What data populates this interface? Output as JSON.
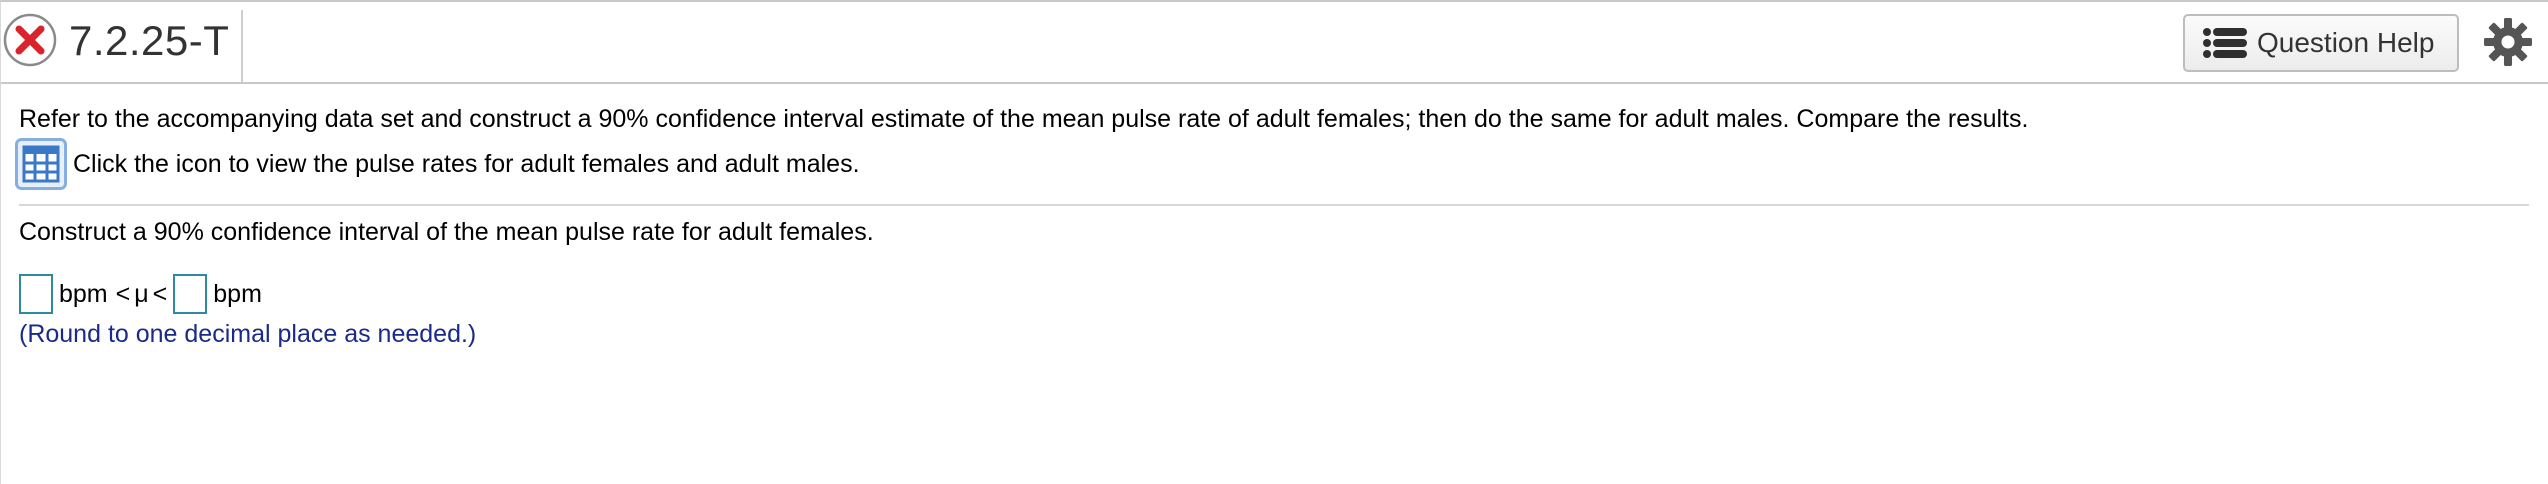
{
  "header": {
    "question_id": "7.2.25-T",
    "help_label": "Question Help"
  },
  "question": {
    "intro": "Refer to the accompanying data set and construct a 90% confidence interval estimate of the mean pulse rate of adult females; then do the same for adult males. Compare the results.",
    "table_link_text": "Click the icon to view the pulse rates for adult females and adult males.",
    "part_prompt": "Construct a 90% confidence interval of the mean pulse rate for adult females.",
    "answer": {
      "lower_value": "",
      "lower_unit": "bpm",
      "lt1": "<",
      "mu": "μ",
      "lt2": "<",
      "upper_value": "",
      "upper_unit": "bpm"
    },
    "hint": "(Round to one decimal place as needed.)"
  },
  "colors": {
    "status_incorrect": "#d9242b",
    "input_border": "#2e8b9e",
    "hint_text": "#1a2a8c",
    "table_icon": "#3a78c8"
  },
  "icons": {
    "status": "x-circle-icon",
    "help": "list-icon",
    "settings": "gear-icon",
    "data_table": "table-grid-icon"
  }
}
